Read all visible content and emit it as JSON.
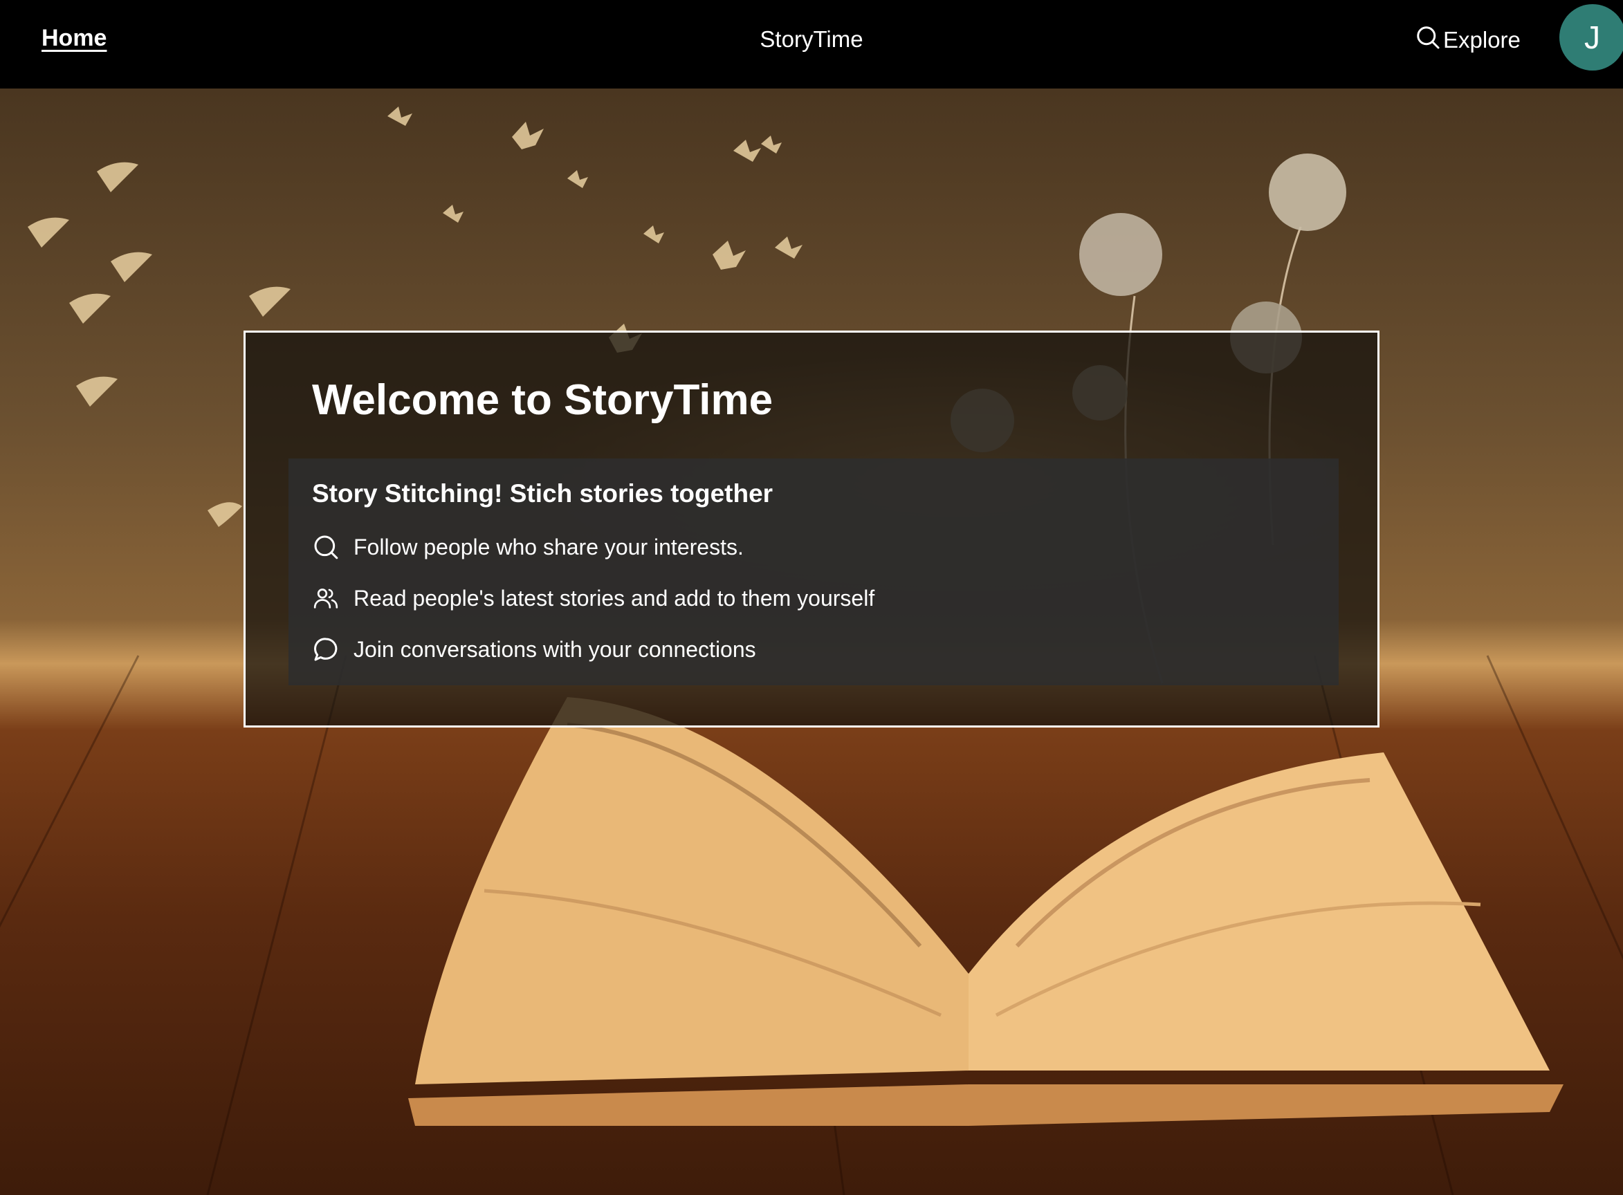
{
  "nav": {
    "home_label": "Home",
    "brand": "StoryTime",
    "explore_label": "Explore",
    "avatar_initial": "J"
  },
  "hero": {
    "title": "Welcome to StoryTime",
    "panel_heading": "Story Stitching! Stich stories together",
    "features": [
      {
        "icon": "search-icon",
        "text": "Follow people who share your interests."
      },
      {
        "icon": "users-icon",
        "text": "Read people's latest stories and add to them yourself"
      },
      {
        "icon": "chat-bubble-icon",
        "text": "Join conversations with your connections"
      }
    ]
  },
  "colors": {
    "navbar_bg": "#000000",
    "avatar_bg": "#2f7d74",
    "text": "#ffffff"
  }
}
